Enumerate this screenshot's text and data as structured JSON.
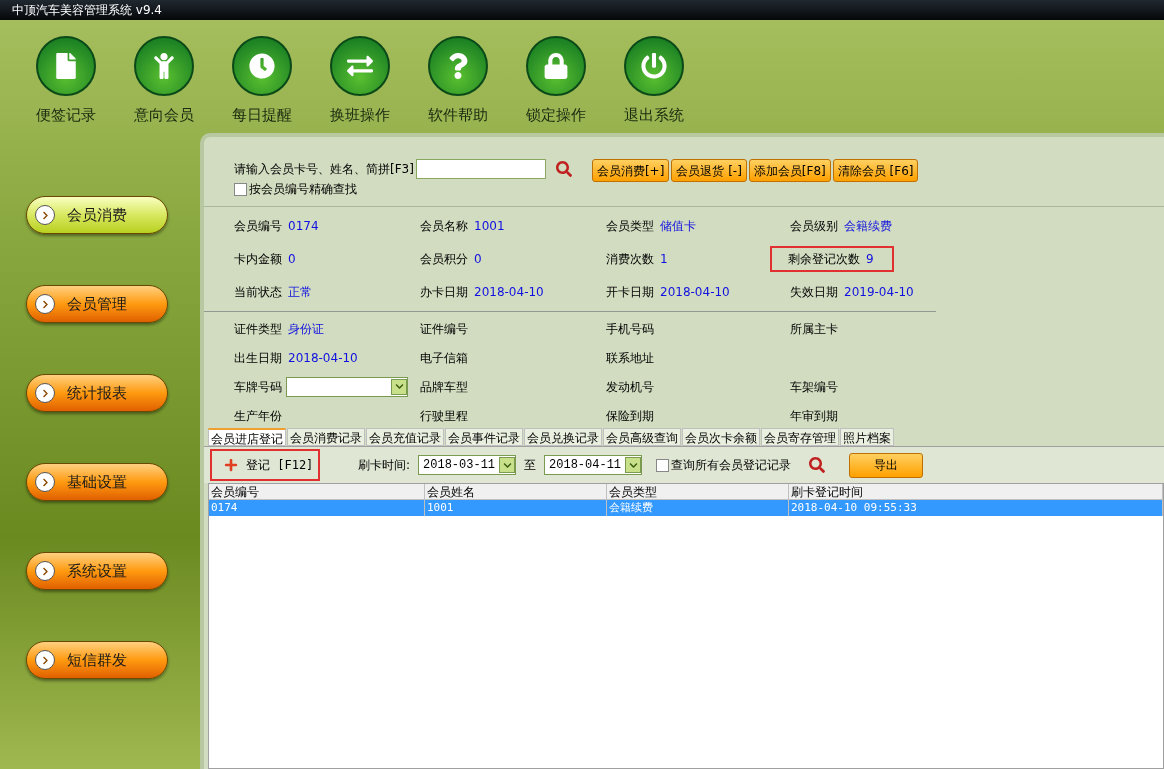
{
  "window": {
    "title": "中顶汽车美容管理系统 v9.4"
  },
  "toolbar": [
    {
      "kind": "note",
      "label": "便签记录"
    },
    {
      "kind": "member",
      "label": "意向会员"
    },
    {
      "kind": "alarm",
      "label": "每日提醒"
    },
    {
      "kind": "shift",
      "label": "换班操作"
    },
    {
      "kind": "help",
      "label": "软件帮助"
    },
    {
      "kind": "lock",
      "label": "锁定操作"
    },
    {
      "kind": "exit",
      "label": "退出系统"
    }
  ],
  "sidebar": {
    "items": [
      {
        "label": "会员消费",
        "selected": true
      },
      {
        "label": "会员管理",
        "selected": false
      },
      {
        "label": "统计报表",
        "selected": false
      },
      {
        "label": "基础设置",
        "selected": false
      },
      {
        "label": "系统设置",
        "selected": false
      },
      {
        "label": "短信群发",
        "selected": false
      }
    ]
  },
  "search": {
    "label": "请输入会员卡号、姓名、简拼[F3]",
    "exact_match": {
      "label": "按会员编号精确查找",
      "checked": false
    }
  },
  "actions": [
    "会员消费[+]",
    "会员退货 [-]",
    "添加会员[F8]",
    "清除会员 [F6]"
  ],
  "member_info": [
    {
      "label": "会员编号",
      "value": "0174",
      "highlighted": false
    },
    {
      "label": "会员名称",
      "value": "1001",
      "highlighted": false
    },
    {
      "label": "会员类型",
      "value": "储值卡",
      "highlighted": false
    },
    {
      "label": "会员级别",
      "value": "会籍续费",
      "highlighted": false
    },
    {
      "label": "卡内金额",
      "value": "0",
      "highlighted": false
    },
    {
      "label": "会员积分",
      "value": "0",
      "highlighted": false
    },
    {
      "label": "消费次数",
      "value": "1",
      "highlighted": false
    },
    {
      "label": "剩余登记次数",
      "value": "9",
      "highlighted": true
    },
    {
      "label": "当前状态",
      "value": "正常",
      "highlighted": false
    },
    {
      "label": "办卡日期",
      "value": "2018-04-10",
      "highlighted": false
    },
    {
      "label": "开卡日期",
      "value": "2018-04-10",
      "highlighted": false
    },
    {
      "label": "失效日期",
      "value": "2019-04-10",
      "highlighted": false
    }
  ],
  "details": [
    {
      "kind": "text",
      "label": "证件类型",
      "value": "身份证"
    },
    {
      "kind": "text",
      "label": "证件编号"
    },
    {
      "kind": "text",
      "label": "手机号码"
    },
    {
      "kind": "text",
      "label": "所属主卡"
    },
    {
      "kind": "text",
      "label": "出生日期",
      "value": "2018-04-10"
    },
    {
      "kind": "text",
      "label": "电子信箱"
    },
    {
      "kind": "text",
      "label": "联系地址"
    },
    {
      "kind": "blank"
    },
    {
      "kind": "select",
      "label": "车牌号码"
    },
    {
      "kind": "text",
      "label": "品牌车型"
    },
    {
      "kind": "text",
      "label": "发动机号"
    },
    {
      "kind": "text",
      "label": "车架编号"
    },
    {
      "kind": "text",
      "label": "生产年份"
    },
    {
      "kind": "text",
      "label": "行驶里程"
    },
    {
      "kind": "text",
      "label": "保险到期"
    },
    {
      "kind": "text",
      "label": "年审到期"
    }
  ],
  "tabs": [
    {
      "label": "会员进店登记",
      "selected": true
    },
    {
      "label": "会员消费记录",
      "selected": false
    },
    {
      "label": "会员充值记录",
      "selected": false
    },
    {
      "label": "会员事件记录",
      "selected": false
    },
    {
      "label": "会员兑换记录",
      "selected": false
    },
    {
      "label": "会员高级查询",
      "selected": false
    },
    {
      "label": "会员次卡余额",
      "selected": false
    },
    {
      "label": "会员寄存管理",
      "selected": false
    },
    {
      "label": "照片档案",
      "selected": false
    }
  ],
  "register_button": {
    "label": "登记 [F12]",
    "highlighted": true
  },
  "filter": {
    "label": "刷卡时间:",
    "from": "2018-03-11",
    "to_label": "至",
    "to": "2018-04-11",
    "all_members": {
      "label": "查询所有会员登记记录",
      "checked": false
    },
    "export": "导出"
  },
  "table": {
    "columns": [
      "会员编号",
      "会员姓名",
      "会员类型",
      "刷卡登记时间"
    ],
    "rows": [
      {
        "cells": [
          "0174",
          "1001",
          "会籍续费",
          "2018-04-10 09:55:33"
        ],
        "selected": true
      }
    ]
  }
}
